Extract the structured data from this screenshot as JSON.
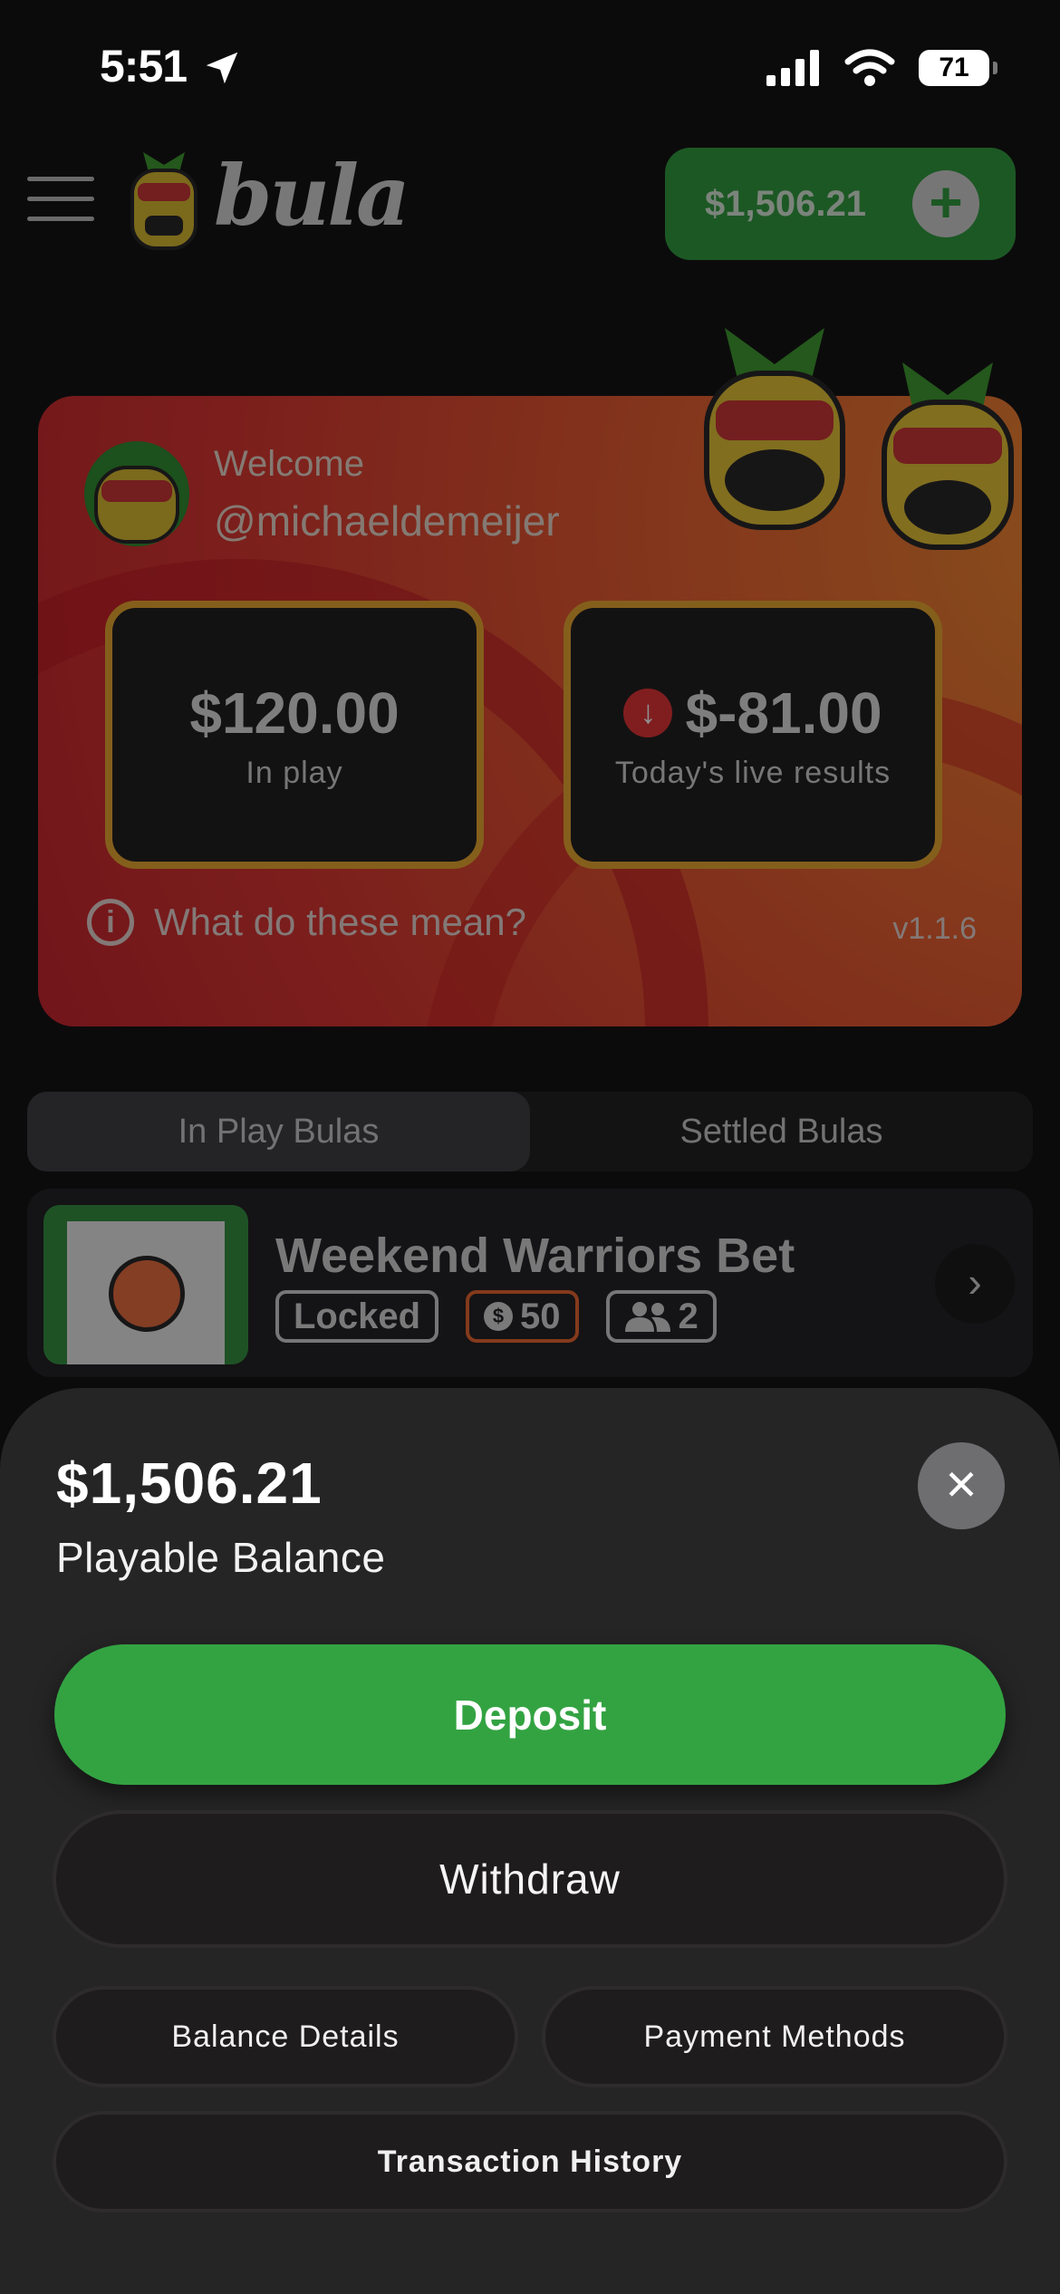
{
  "status_bar": {
    "time": "5:51",
    "battery": "71"
  },
  "header": {
    "brand": "bula",
    "balance": "$1,506.21"
  },
  "hero": {
    "welcome": "Welcome",
    "username": "@michaeldemeijer",
    "in_play_value": "$120.00",
    "in_play_label": "In play",
    "live_value": "$-81.00",
    "live_label": "Today's live results",
    "info_text": "What do these mean?",
    "version": "v1.1.6"
  },
  "tabs": [
    {
      "label": "In Play Bulas",
      "active": true
    },
    {
      "label": "Settled Bulas",
      "active": false
    }
  ],
  "bet": {
    "title": "Weekend Warriors Bet",
    "status": "Locked",
    "coins": "50",
    "players": "2"
  },
  "sheet": {
    "amount": "$1,506.21",
    "subtitle": "Playable Balance",
    "deposit": "Deposit",
    "withdraw": "Withdraw",
    "balance_details": "Balance Details",
    "payment_methods": "Payment Methods",
    "transaction_history": "Transaction History"
  },
  "colors": {
    "accent_green": "#33a342",
    "hero_orange": "#e8602b",
    "card_border": "#e8a72a",
    "loss_red": "#e03030"
  }
}
